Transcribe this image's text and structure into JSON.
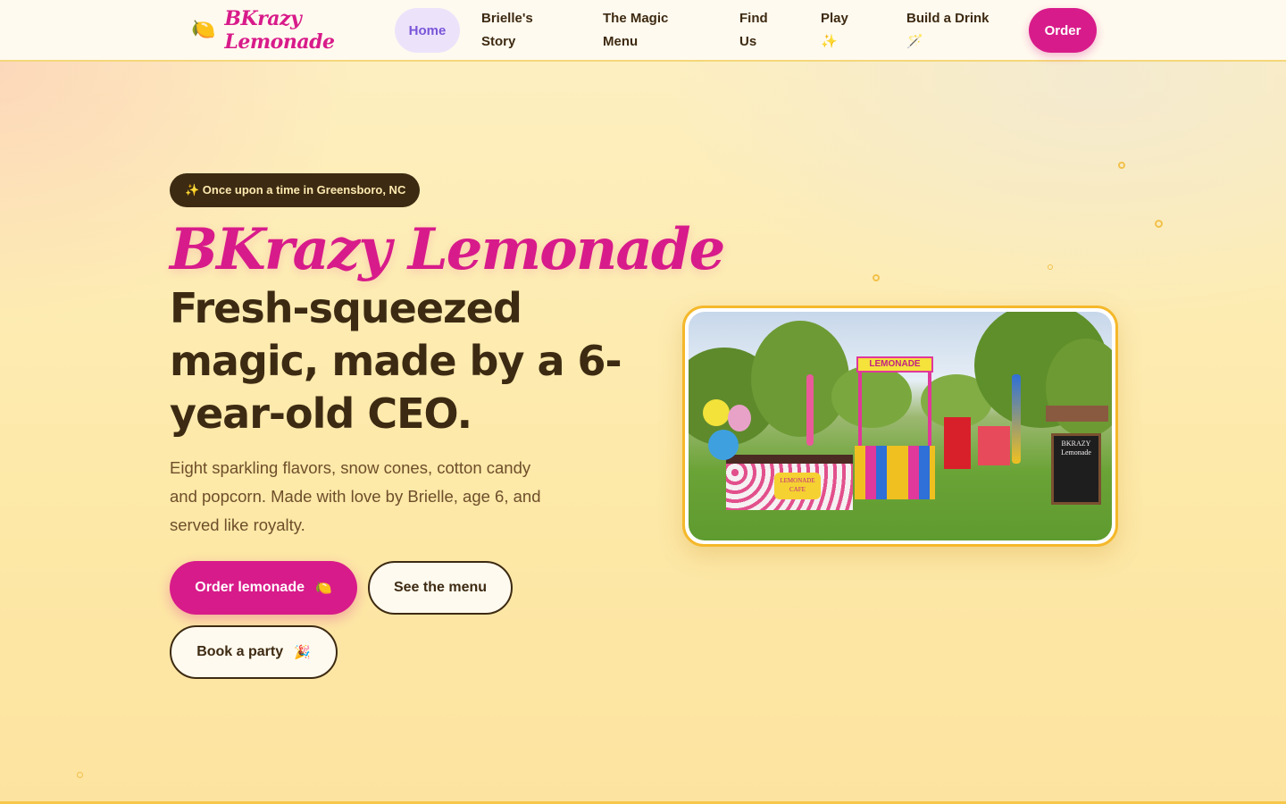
{
  "nav": {
    "logo_icon": "🍋",
    "logo_text": "BKrazy Lemonade",
    "items": [
      {
        "label": "Home"
      },
      {
        "label": "Brielle's Story"
      },
      {
        "label": "The Magic Menu"
      },
      {
        "label": "Find Us"
      },
      {
        "label": "Play ✨"
      },
      {
        "label": "Build a Drink 🪄"
      }
    ],
    "order_label": "Order"
  },
  "hero": {
    "badge": "✨ Once upon a time in Greensboro, NC",
    "brand": "BKrazy Lemonade",
    "headline": "Fresh-squeezed magic, made by a 6-year-old CEO.",
    "description": "Eight sparkling flavors, snow cones, cotton candy and popcorn. Made with love by Brielle, age 6, and served like royalty.",
    "buttons": {
      "order": {
        "label": "Order lemonade",
        "emoji": "🍋"
      },
      "menu": {
        "label": "See the menu"
      },
      "party": {
        "label": "Book a party",
        "emoji": "🎉"
      }
    }
  },
  "photo": {
    "stand_sign": "LEMONADE",
    "cart_sign": "LEMONADE CAFE",
    "chalkboard": "BKRAZY Lemonade"
  },
  "colors": {
    "accent": "#d81b8a",
    "text": "#3d2a12",
    "home_tab_bg": "#ece3fb",
    "home_tab_text": "#7a55d8",
    "frame": "#f5b82a"
  }
}
